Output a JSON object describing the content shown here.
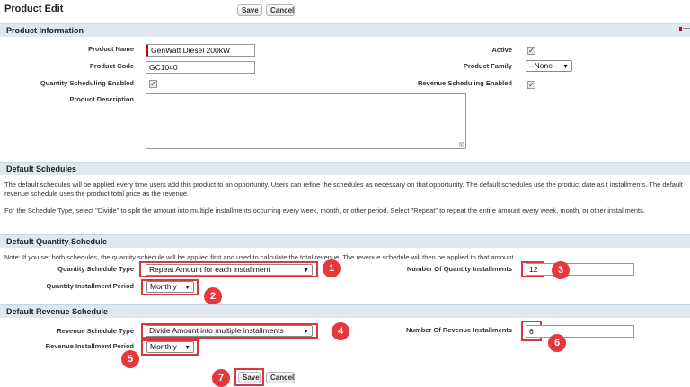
{
  "header": {
    "title": "Product Edit",
    "save_label": "Save",
    "cancel_label": "Cancel"
  },
  "product_info": {
    "section_title": "Product Information",
    "product_name_label": "Product Name",
    "product_name_value": "GenWatt Diesel 200kW",
    "product_code_label": "Product Code",
    "product_code_value": "GC1040",
    "qty_sched_label": "Quantity Scheduling Enabled",
    "qty_sched_checked": true,
    "description_label": "Product Description",
    "description_value": "",
    "active_label": "Active",
    "active_checked": true,
    "family_label": "Product Family",
    "family_value": "--None--",
    "rev_sched_label": "Revenue Scheduling Enabled",
    "rev_sched_checked": true
  },
  "default_schedules": {
    "section_title": "Default Schedules",
    "paragraph1": "The default schedules will be applied every time users add this product to an opportunity. Users can refine the schedules as necessary on that opportunity. The default schedules use the product date as t installments. The default revenue schedule uses the product total price as the revenue.",
    "paragraph2": "For the Schedule Type, select \"Divide\" to split the amount into multiple installments occurring every week, month, or other period. Select \"Repeat\" to repeat the entire amount every week, month, or other installments."
  },
  "quantity_schedule": {
    "section_title": "Default Quantity Schedule",
    "note": "Note: If you set both schedules, the quantity schedule will be applied first and used to calculate the total revenue. The revenue schedule will then be applied to that amount.",
    "type_label": "Quantity Schedule Type",
    "type_value": "Repeat Amount for each installment",
    "period_label": "Quantity Installment Period",
    "period_value": "Monthly",
    "installments_label": "Number Of Quantity Installments",
    "installments_value": "12"
  },
  "revenue_schedule": {
    "section_title": "Default Revenue Schedule",
    "type_label": "Revenue Schedule Type",
    "type_value": "Divide Amount into multiple installments",
    "period_label": "Revenue Installment Period",
    "period_value": "Monthly",
    "installments_label": "Number Of Revenue Installments",
    "installments_value": "6"
  },
  "footer": {
    "save_label": "Save",
    "cancel_label": "Cancel"
  },
  "annotations": [
    "1",
    "2",
    "3",
    "4",
    "5",
    "6",
    "7"
  ],
  "colors": {
    "section_bg": "#dfe8f1",
    "highlight": "#d9363e",
    "badge": "#e5383b",
    "required": "#cc0000"
  }
}
